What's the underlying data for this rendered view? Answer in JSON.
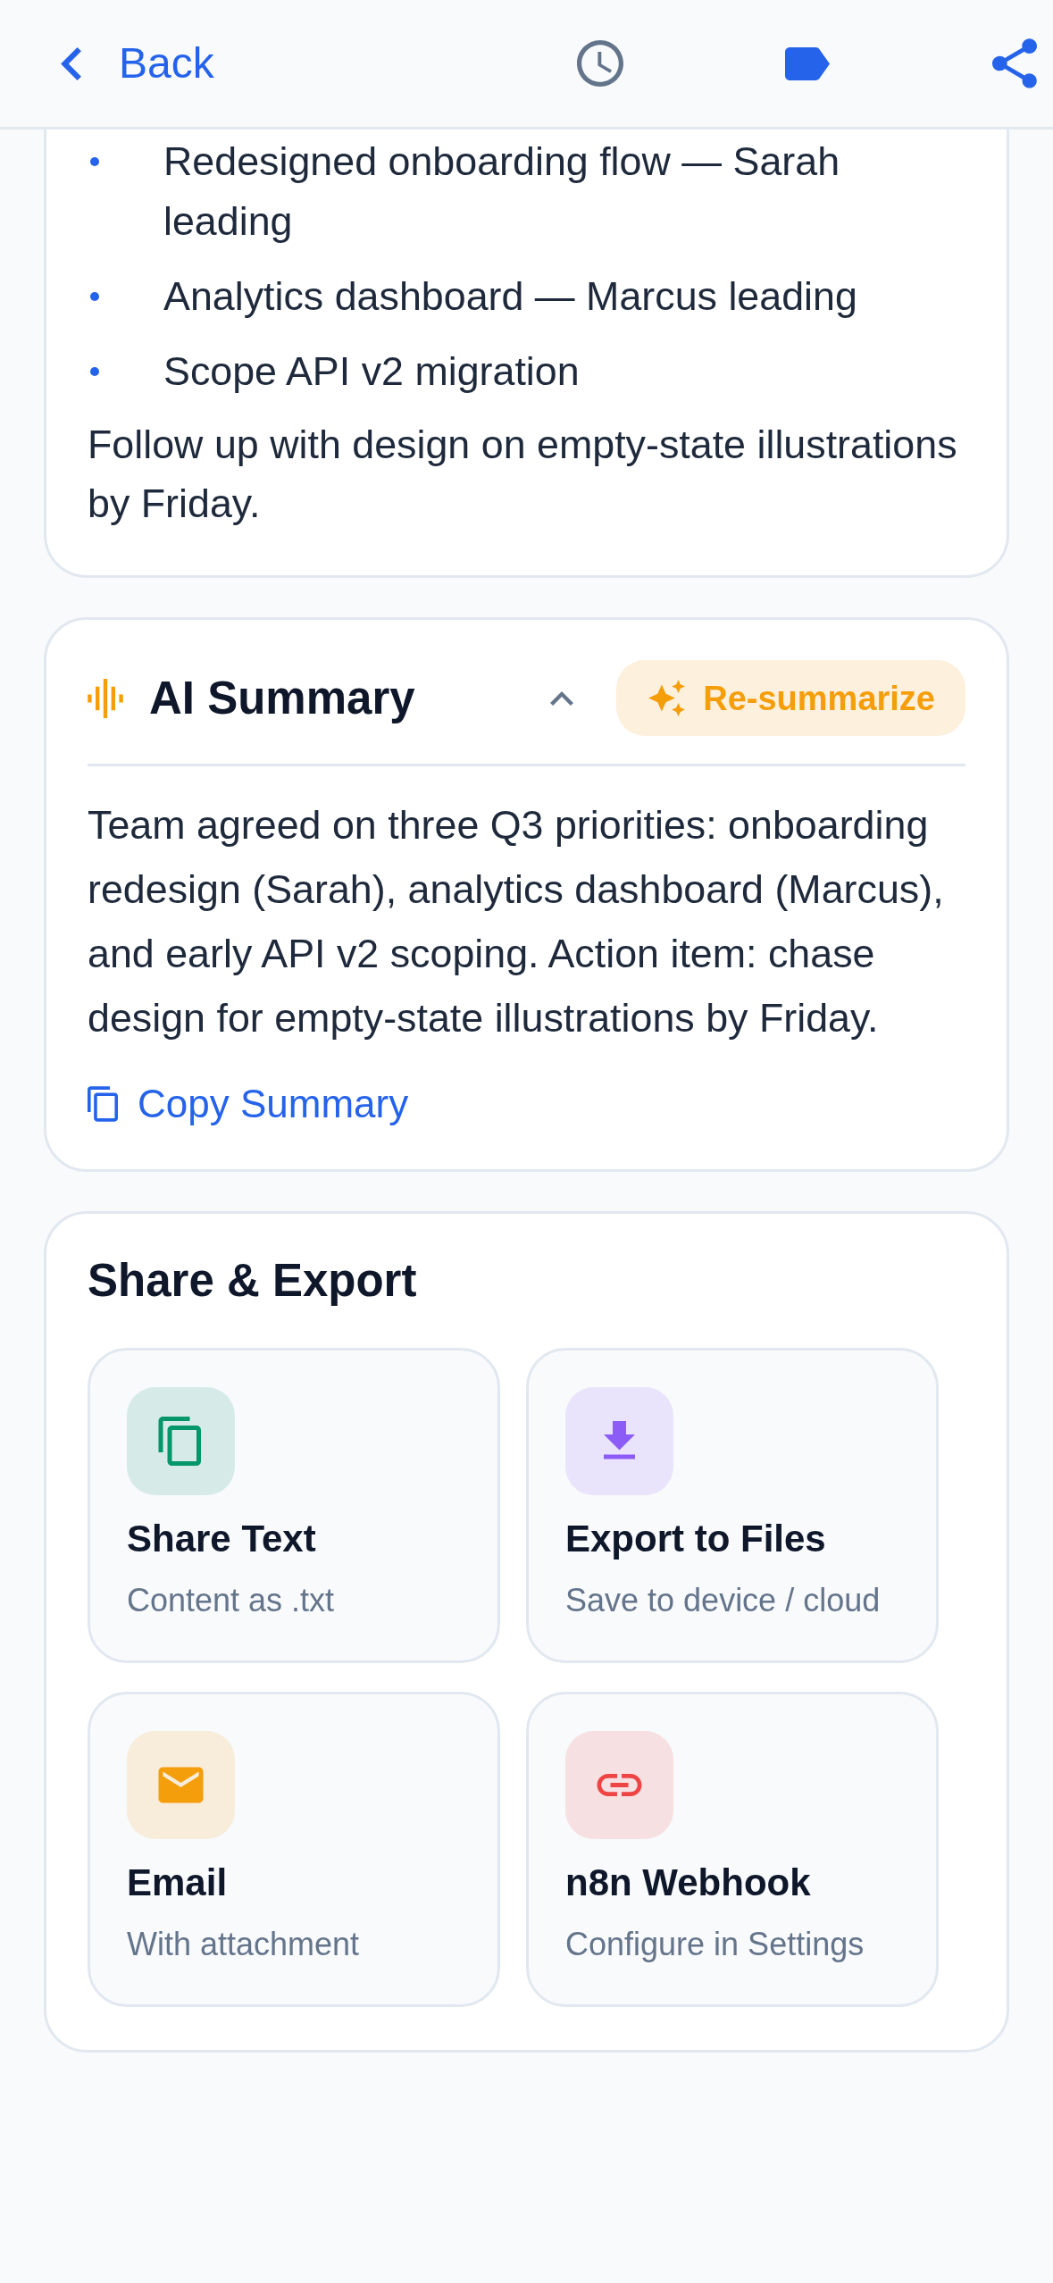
{
  "top_bar": {
    "back_label": "Back"
  },
  "notes_card": {
    "bullets": [
      "Redesigned onboarding flow — Sarah leading",
      "Analytics dashboard — Marcus leading",
      "Scope API v2 migration"
    ],
    "paragraph": "Follow up with design on empty-state illustrations by Friday."
  },
  "summary_card": {
    "title": "AI Summary",
    "expanded": true,
    "action_label": "Re-summarize",
    "text": "Team agreed on three Q3 priorities: onboarding redesign (Sarah), analytics dashboard (Marcus), and early API v2 scoping. Action item: chase design for empty-state illustrations by Friday.",
    "copy_label": "Copy Summary"
  },
  "share_export": {
    "title": "Share & Export",
    "options": [
      {
        "kind": "copy",
        "title": "Share Text",
        "subtitle": "Content as .txt",
        "color": "#059669"
      },
      {
        "kind": "download",
        "title": "Export to Files",
        "subtitle": "Save to device / cloud",
        "color": "#8b5cf6"
      },
      {
        "kind": "email",
        "title": "Email",
        "subtitle": "With attachment",
        "color": "#f59e0b"
      },
      {
        "kind": "link",
        "title": "n8n Webhook",
        "subtitle": "Configure in Settings",
        "color": "#ef4444"
      }
    ]
  }
}
